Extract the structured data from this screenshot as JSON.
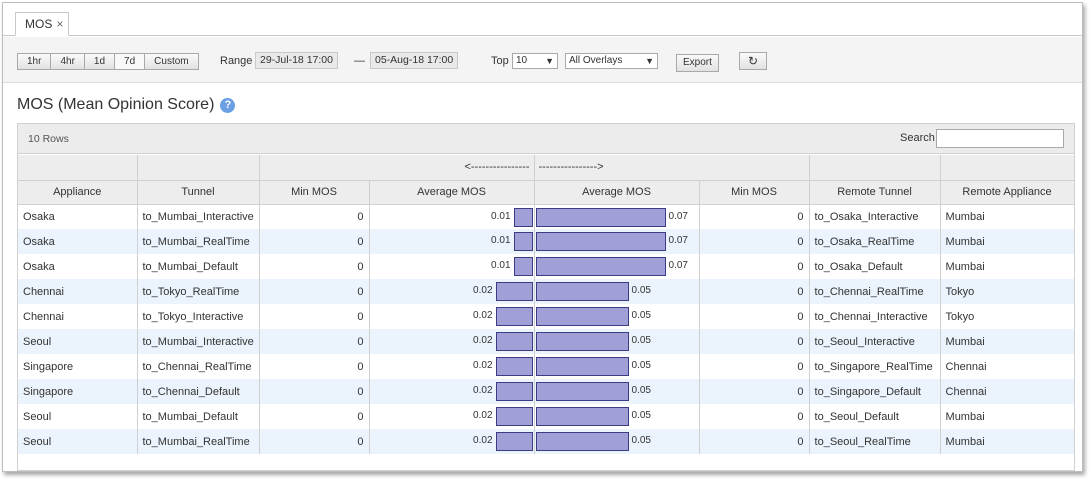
{
  "tab": {
    "label": "MOS",
    "close": "×"
  },
  "toolbar": {
    "ranges": [
      "1hr",
      "4hr",
      "1d",
      "7d",
      "Custom"
    ],
    "active_range": "7d",
    "range_label": "Range",
    "from": "29-Jul-18 17:00",
    "dash": "—",
    "to": "05-Aug-18 17:00",
    "top_label": "Top",
    "top_value": "10",
    "overlay_value": "All Overlays",
    "export_label": "Export",
    "refresh_glyph": "↻"
  },
  "page_title": "MOS (Mean Opinion Score)",
  "help_glyph": "?",
  "grid": {
    "rows_label": "10 Rows",
    "search_label": "Search",
    "left_arrow": "<----------------",
    "right_arrow": "---------------->",
    "columns": [
      "Appliance",
      "Tunnel",
      "Min MOS",
      "Average MOS",
      "Average MOS",
      "Min MOS",
      "Remote Tunnel",
      "Remote Appliance"
    ],
    "bar_scale_max": 0.07,
    "bar_color": "#a09fd6",
    "rows": [
      {
        "appliance": "Osaka",
        "tunnel": "to_Mumbai_Interactive",
        "min_mos": "0",
        "avg_mos": "0.01",
        "r_avg_mos": "0.07",
        "r_min_mos": "0",
        "remote_tunnel": "to_Osaka_Interactive",
        "remote_appliance": "Mumbai"
      },
      {
        "appliance": "Osaka",
        "tunnel": "to_Mumbai_RealTime",
        "min_mos": "0",
        "avg_mos": "0.01",
        "r_avg_mos": "0.07",
        "r_min_mos": "0",
        "remote_tunnel": "to_Osaka_RealTime",
        "remote_appliance": "Mumbai"
      },
      {
        "appliance": "Osaka",
        "tunnel": "to_Mumbai_Default",
        "min_mos": "0",
        "avg_mos": "0.01",
        "r_avg_mos": "0.07",
        "r_min_mos": "0",
        "remote_tunnel": "to_Osaka_Default",
        "remote_appliance": "Mumbai"
      },
      {
        "appliance": "Chennai",
        "tunnel": "to_Tokyo_RealTime",
        "min_mos": "0",
        "avg_mos": "0.02",
        "r_avg_mos": "0.05",
        "r_min_mos": "0",
        "remote_tunnel": "to_Chennai_RealTime",
        "remote_appliance": "Tokyo"
      },
      {
        "appliance": "Chennai",
        "tunnel": "to_Tokyo_Interactive",
        "min_mos": "0",
        "avg_mos": "0.02",
        "r_avg_mos": "0.05",
        "r_min_mos": "0",
        "remote_tunnel": "to_Chennai_Interactive",
        "remote_appliance": "Tokyo"
      },
      {
        "appliance": "Seoul",
        "tunnel": "to_Mumbai_Interactive",
        "min_mos": "0",
        "avg_mos": "0.02",
        "r_avg_mos": "0.05",
        "r_min_mos": "0",
        "remote_tunnel": "to_Seoul_Interactive",
        "remote_appliance": "Mumbai"
      },
      {
        "appliance": "Singapore",
        "tunnel": "to_Chennai_RealTime",
        "min_mos": "0",
        "avg_mos": "0.02",
        "r_avg_mos": "0.05",
        "r_min_mos": "0",
        "remote_tunnel": "to_Singapore_RealTime",
        "remote_appliance": "Chennai"
      },
      {
        "appliance": "Singapore",
        "tunnel": "to_Chennai_Default",
        "min_mos": "0",
        "avg_mos": "0.02",
        "r_avg_mos": "0.05",
        "r_min_mos": "0",
        "remote_tunnel": "to_Singapore_Default",
        "remote_appliance": "Chennai"
      },
      {
        "appliance": "Seoul",
        "tunnel": "to_Mumbai_Default",
        "min_mos": "0",
        "avg_mos": "0.02",
        "r_avg_mos": "0.05",
        "r_min_mos": "0",
        "remote_tunnel": "to_Seoul_Default",
        "remote_appliance": "Mumbai"
      },
      {
        "appliance": "Seoul",
        "tunnel": "to_Mumbai_RealTime",
        "min_mos": "0",
        "avg_mos": "0.02",
        "r_avg_mos": "0.05",
        "r_min_mos": "0",
        "remote_tunnel": "to_Seoul_RealTime",
        "remote_appliance": "Mumbai"
      }
    ]
  }
}
